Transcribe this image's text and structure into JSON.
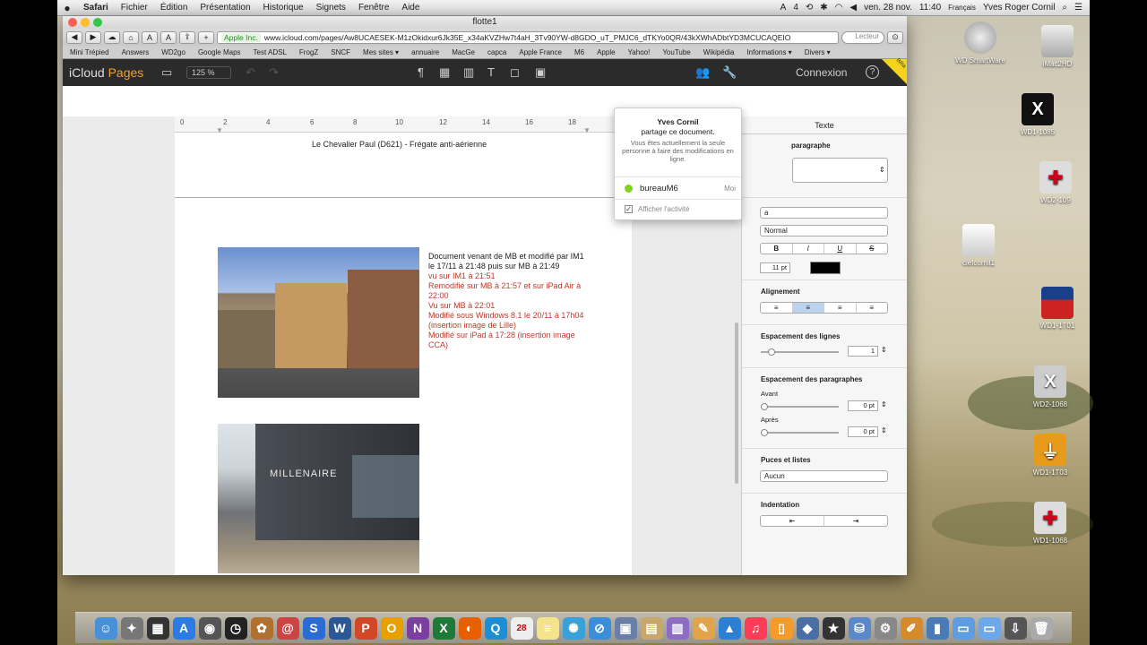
{
  "menubar": {
    "apple": "",
    "items": [
      "Safari",
      "Fichier",
      "Édition",
      "Présentation",
      "Historique",
      "Signets",
      "Fenêtre",
      "Aide"
    ],
    "status": [
      "4",
      "ven. 28 nov.",
      "11:40",
      "Français",
      "Yves Roger Cornil"
    ]
  },
  "browser": {
    "window_title": "flotte1",
    "cert_label": "Apple Inc.",
    "url": "www.icloud.com/pages/Aw8UCAESEK-M1zOkidxur6Jk35E_x34aKVZHw7t4aH_3Tv90YW-d8GDO_uT_PMJC6_dTKYo0QR/43kXWhADbtYD3MCUCAQEIO",
    "reader_label": "Lecteur",
    "bookmarks": [
      "Mini Trépied",
      "Answers",
      "WD2go",
      "Google Maps",
      "Test ADSL",
      "FrogZ",
      "SNCF",
      "Mes sites ▾",
      "annuaire",
      "MacGe",
      "capca",
      "Apple France",
      "M6",
      "Apple",
      "Yahoo!",
      "YouTube",
      "Wikipédia",
      "Informations ▾",
      "Divers ▾"
    ]
  },
  "icloud": {
    "brand_prefix": "iCloud",
    "brand_app": "Pages",
    "zoom": "125 %",
    "login": "Connexion",
    "help": "?",
    "beta": "Bêta"
  },
  "ruler": {
    "ticks": [
      "0",
      "2",
      "4",
      "6",
      "8",
      "10",
      "12",
      "14",
      "16",
      "18"
    ]
  },
  "document": {
    "header": "Le Chevalier Paul (D621) - Frégate anti-aérienne",
    "intro": "Document venant de MB et modifié par IM1 le 17/11 à 21:48 puis sur MB à 21:49",
    "edits": [
      "vu sur IM1 à 21:51",
      "Remodifié sur MB à 21:57 et sur iPad Air à 22:00",
      "Vu sur MB à 22:01",
      "Modifié sous Windows 8.1 le 20/11 à 17h04 (insertion image de Lille)",
      "Modifié sur iPad à 17:28 (insertion image CCA)"
    ],
    "sign_text": "MILLENAIRE"
  },
  "popover": {
    "owner": "Yves Cornil",
    "line": "partage ce document.",
    "note": "Vous êtes actuellement la seule personne à faire des modifications en ligne.",
    "user": "bureauM6",
    "me": "Moi",
    "show_activity": "Afficher l'activité"
  },
  "inspector": {
    "tab": "Texte",
    "style_title": "paragraphe",
    "font_partial": "a",
    "weight": "Normal",
    "bold": "B",
    "italic": "I",
    "underline": "U",
    "strike": "S",
    "size": "11 pt",
    "alignment_title": "Alignement",
    "line_spacing_title": "Espacement des lignes",
    "line_spacing_value": "1",
    "para_spacing_title": "Espacement des paragraphes",
    "before_label": "Avant",
    "before_value": "0 pt",
    "after_label": "Après",
    "after_value": "0 pt",
    "bullets_title": "Puces et listes",
    "bullets_value": "Aucun",
    "indent_title": "Indentation"
  },
  "desktop_icons": [
    "WD SmartWare",
    "iMac2HD",
    "WD1-1085",
    "WD2-109",
    "clefcornil1",
    "WD1-1T01",
    "WD2-1068",
    "WD1-1T03",
    "WD1-1068"
  ]
}
